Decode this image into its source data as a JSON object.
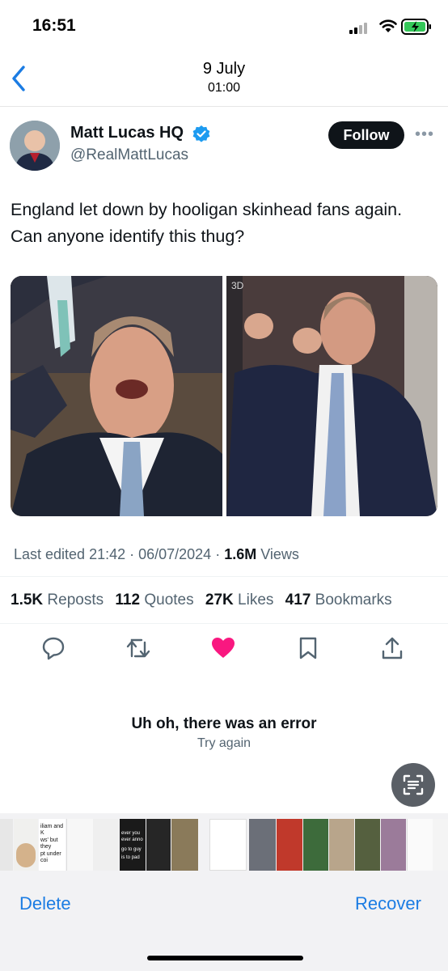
{
  "status_bar": {
    "time": "16:51"
  },
  "header": {
    "date": "9 July",
    "time": "01:00"
  },
  "tweet": {
    "display_name": "Matt Lucas HQ",
    "handle": "@RealMattLucas",
    "follow_label": "Follow",
    "more_label": "•••",
    "text": "England let down by hooligan skinhead fans again. Can anyone identify this thug?",
    "photo_badge": "3D",
    "meta": {
      "edited": "Last edited 21:42 · 06/07/2024 · ",
      "views_count": "1.6M",
      "views_label": " Views"
    },
    "stats": [
      {
        "count": "1.5K",
        "label": "Reposts"
      },
      {
        "count": "112",
        "label": "Quotes"
      },
      {
        "count": "27K",
        "label": "Likes"
      },
      {
        "count": "417",
        "label": "Bookmarks"
      }
    ],
    "actions": [
      "reply-icon",
      "repost-icon",
      "like-icon",
      "bookmark-icon",
      "share-icon"
    ],
    "like_color": "#f91880"
  },
  "error": {
    "title": "Uh oh, there was an error",
    "retry": "Try again"
  },
  "bottom_bar": {
    "delete_label": "Delete",
    "recover_label": "Recover",
    "accent": "#1b7ce3"
  },
  "filmstrip": {
    "thumb_texts": [
      "iliam and K",
      "ws' but they",
      "pt under coi",
      "ever you ever anno",
      "go to guy",
      "is to pad"
    ]
  }
}
